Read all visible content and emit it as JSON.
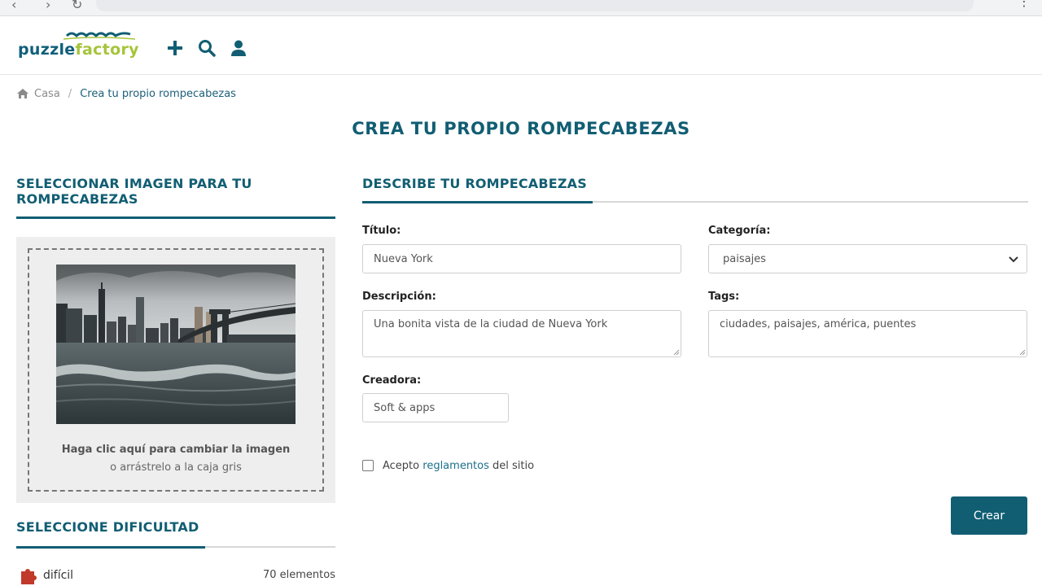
{
  "colors": {
    "brand": "#115e73",
    "logo_green": "#a6c43a",
    "button": "#115e73"
  },
  "browser": {
    "menu_icon": "kebab-menu-icon"
  },
  "header": {
    "logo_part1": "puzzle",
    "logo_part2": "factory",
    "icons": [
      "plus-icon",
      "search-icon",
      "user-icon"
    ]
  },
  "breadcrumb": {
    "home": "Casa",
    "separator": "/",
    "current": "Crea tu propio rompecabezas"
  },
  "page_title": "CREA TU PROPIO ROMPECABEZAS",
  "upload": {
    "title": "SELECCIONAR IMAGEN PARA TU ROMPECABEZAS",
    "hint_main": "Haga clic aquí para cambiar la imagen",
    "hint_sub": "o arrástrelo a la caja gris"
  },
  "difficulty": {
    "title": "SELECCIONE DIFICULTAD",
    "items": [
      {
        "label": "difícil",
        "count": "70 elementos"
      }
    ]
  },
  "form": {
    "title": "DESCRIBE TU ROMPECABEZAS",
    "titulo_label": "Título:",
    "titulo_value": "Nueva York",
    "categoria_label": "Categoría:",
    "categoria_value": "paisajes",
    "descripcion_label": "Descripción:",
    "descripcion_value": "Una bonita vista de la ciudad de Nueva York",
    "tags_label": "Tags:",
    "tags_value": "ciudades, paisajes, américa, puentes",
    "creadora_label": "Creadora:",
    "creadora_value": "Soft & apps",
    "terms_pre": "Acepto",
    "terms_link": "reglamentos",
    "terms_post": "del sitio",
    "submit": "Crear"
  }
}
